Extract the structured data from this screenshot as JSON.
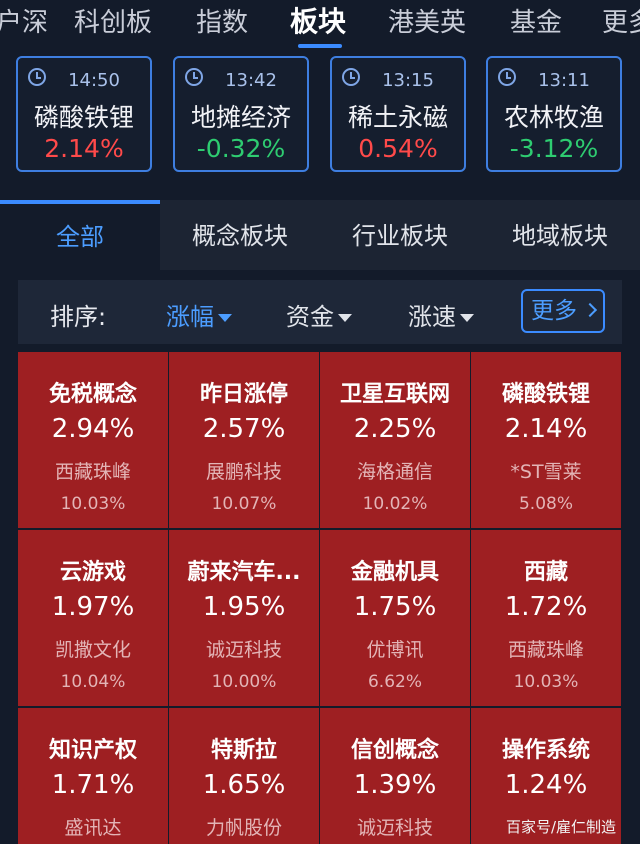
{
  "topnav": {
    "tabs": [
      {
        "label": "户深"
      },
      {
        "label": "科创板"
      },
      {
        "label": "指数"
      },
      {
        "label": "板块",
        "active": true
      },
      {
        "label": "港美英"
      },
      {
        "label": "基金"
      },
      {
        "label": "更多"
      }
    ]
  },
  "hot_cards": [
    {
      "time": "14:50",
      "name": "磷酸铁锂",
      "change": "2.14%",
      "direction": "up"
    },
    {
      "time": "13:42",
      "name": "地摊经济",
      "change": "-0.32%",
      "direction": "down"
    },
    {
      "time": "13:15",
      "name": "稀土永磁",
      "change": "0.54%",
      "direction": "up"
    },
    {
      "time": "13:11",
      "name": "农林牧渔",
      "change": "-3.12%",
      "direction": "down"
    }
  ],
  "category_tabs": [
    {
      "label": "全部",
      "active": true
    },
    {
      "label": "概念板块"
    },
    {
      "label": "行业板块"
    },
    {
      "label": "地域板块"
    }
  ],
  "sort_bar": {
    "label": "排序:",
    "options": [
      {
        "label": "涨幅",
        "active": true
      },
      {
        "label": "资金"
      },
      {
        "label": "涨速"
      }
    ],
    "more_label": "更多"
  },
  "sectors": [
    {
      "name": "免税概念",
      "change": "2.94%",
      "lead_stock": "西藏珠峰",
      "lead_change": "10.03%"
    },
    {
      "name": "昨日涨停",
      "change": "2.57%",
      "lead_stock": "展鹏科技",
      "lead_change": "10.07%"
    },
    {
      "name": "卫星互联网",
      "change": "2.25%",
      "lead_stock": "海格通信",
      "lead_change": "10.02%"
    },
    {
      "name": "磷酸铁锂",
      "change": "2.14%",
      "lead_stock": "*ST雪莱",
      "lead_change": "5.08%"
    },
    {
      "name": "云游戏",
      "change": "1.97%",
      "lead_stock": "凯撒文化",
      "lead_change": "10.04%"
    },
    {
      "name": "蔚来汽车...",
      "change": "1.95%",
      "lead_stock": "诚迈科技",
      "lead_change": "10.00%"
    },
    {
      "name": "金融机具",
      "change": "1.75%",
      "lead_stock": "优博讯",
      "lead_change": "6.62%"
    },
    {
      "name": "西藏",
      "change": "1.72%",
      "lead_stock": "西藏珠峰",
      "lead_change": "10.03%"
    },
    {
      "name": "知识产权",
      "change": "1.71%",
      "lead_stock": "盛讯达",
      "lead_change": ""
    },
    {
      "name": "特斯拉",
      "change": "1.65%",
      "lead_stock": "力帆股份",
      "lead_change": ""
    },
    {
      "name": "信创概念",
      "change": "1.39%",
      "lead_stock": "诚迈科技",
      "lead_change": ""
    },
    {
      "name": "操作系统",
      "change": "1.24%",
      "lead_stock": "",
      "lead_change": ""
    }
  ],
  "watermark": "百家号/雇仁制造",
  "colors": {
    "background": "#131b2a",
    "accent": "#3b8bff",
    "up": "#ff4a4a",
    "down": "#2ecc71",
    "cell": "#9e1f22"
  }
}
